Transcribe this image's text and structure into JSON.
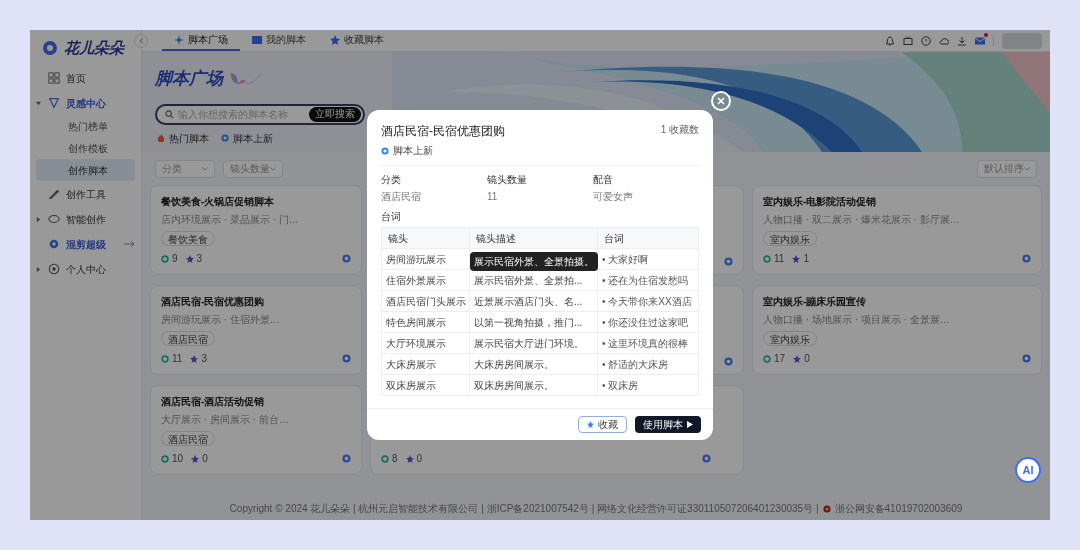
{
  "sidebar": {
    "logo": "花儿朵朵",
    "items": [
      {
        "label": "首页",
        "active": false,
        "external": false
      },
      {
        "label": "灵感中心",
        "active": true,
        "external": false,
        "expanded": true,
        "children": [
          {
            "label": "热门榜单",
            "selected": false
          },
          {
            "label": "创作模板",
            "selected": false
          },
          {
            "label": "创作脚本",
            "selected": true
          }
        ]
      },
      {
        "label": "创作工具",
        "active": false,
        "external": false
      },
      {
        "label": "智能创作",
        "active": false,
        "external": false,
        "expanded": false
      },
      {
        "label": "混剪超级",
        "active": true,
        "external": true
      },
      {
        "label": "个人中心",
        "active": false,
        "external": false,
        "expanded": false
      }
    ]
  },
  "tabs": [
    {
      "label": "脚本广场",
      "selected": true
    },
    {
      "label": "我的脚本",
      "selected": false
    },
    {
      "label": "收藏脚本",
      "selected": false
    }
  ],
  "toolbar": {
    "mail_unread": true
  },
  "header": {
    "title": "脚本广场",
    "search": {
      "placeholder": "输入你想搜索的脚本名称",
      "button": "立即搜索"
    },
    "quick_filters": [
      "热门脚本",
      "脚本上新"
    ],
    "filters": [
      {
        "placeholder": "分类"
      },
      {
        "placeholder": "镜头数量"
      }
    ],
    "sort": "默认排序"
  },
  "card_rows": [
    [
      {
        "kind": "full",
        "title": "餐饮美食-火锅店促销脚本",
        "desc": "店内环境展示 · 菜品展示 · 门…",
        "tag": "餐饮美食",
        "views": "9",
        "stars": "3"
      },
      {
        "kind": "covered"
      },
      {
        "kind": "full",
        "title": "室内娱乐-电影院活动促销",
        "desc": "人物口播 · 双二展示 · 爆米花展示 · 影厅展…",
        "tag": "室内娱乐",
        "views": "11",
        "stars": "1"
      }
    ],
    [
      {
        "kind": "full",
        "title": "酒店民宿-民宿优惠团购",
        "desc": "房间游玩展示 · 住宿外景…",
        "tag": "酒店民宿",
        "views": "11",
        "stars": "3"
      },
      {
        "kind": "covered"
      },
      {
        "kind": "full",
        "title": "室内娱乐-蹦床乐园宣传",
        "desc": "人物口播 · 场地展示 · 项目展示 · 全景展…",
        "tag": "室内娱乐",
        "views": "17",
        "stars": "0"
      }
    ],
    [
      {
        "kind": "full",
        "title": "酒店民宿-酒店活动促销",
        "desc": "大厅展示 · 房间展示 · 前台…",
        "tag": "酒店民宿",
        "views": "10",
        "stars": "0"
      },
      {
        "kind": "footer",
        "views": "8",
        "stars": "0"
      }
    ]
  ],
  "footer": {
    "copyright": "Copyright © 2024 花儿朵朵 | 杭州元启智能技术有限公司 | 浙ICP备2021007542号 | 网络文化经营许可证330110507206401230035号 |",
    "police": "浙公网安备41019702003609"
  },
  "assistant": {
    "label": "AI"
  },
  "modal": {
    "title": "酒店民宿-民宿优惠团购",
    "count": "1 收藏数",
    "tag": "脚本上新",
    "fields": [
      {
        "label": "分类",
        "value": "酒店民宿"
      },
      {
        "label": "镜头数量",
        "value": "11"
      },
      {
        "label": "配音",
        "value": "可爱女声"
      }
    ],
    "section": "台词",
    "columns": [
      "镜头",
      "镜头描述",
      "台词"
    ],
    "rows": [
      {
        "shot": "房间游玩展示",
        "line": "• 大家好啊"
      },
      {
        "shot": "住宿外景展示",
        "description": "展示民宿外景、全景拍...",
        "line": "• 还在为住宿发愁吗"
      },
      {
        "shot": "酒店民宿门头展示",
        "description": "近景展示酒店门头、名...",
        "line": "• 今天带你来XX酒店"
      },
      {
        "shot": "特色房间展示",
        "description": "以第一视角拍摄，推门...",
        "line": "• 你还没住过这家吧"
      },
      {
        "shot": "大厅环境展示",
        "description": "展示民宿大厅进门环境。",
        "line": "• 这里环境真的很棒"
      },
      {
        "shot": "大床房展示",
        "description": "大床房房间展示。",
        "line": "• 舒适的大床房"
      },
      {
        "shot": "双床房展示",
        "description": "双床房房间展示。",
        "line": "• 双床房"
      }
    ],
    "tooltip": "展示民宿外景、全景拍摄。",
    "buttons": {
      "favorite": "收藏",
      "use": "使用脚本"
    }
  }
}
